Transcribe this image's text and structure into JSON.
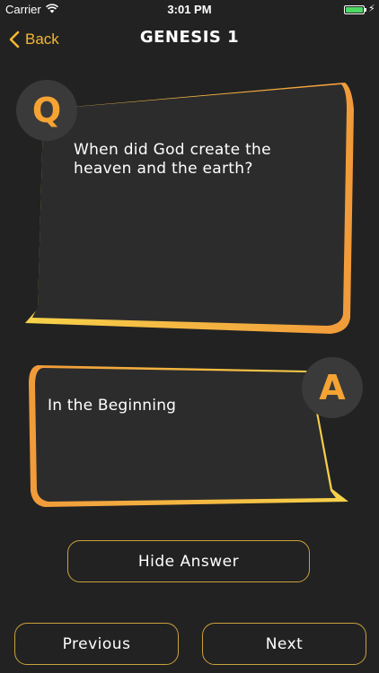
{
  "status_bar": {
    "carrier": "Carrier",
    "time": "3:01 PM"
  },
  "nav": {
    "back_label": "Back",
    "title": "GENESIS 1"
  },
  "question": {
    "badge": "Q",
    "text": "When did God create the heaven and the earth?"
  },
  "answer": {
    "badge": "A",
    "text": "In the Beginning"
  },
  "buttons": {
    "hide_answer": "Hide Answer",
    "previous": "Previous",
    "next": "Next"
  },
  "colors": {
    "background": "#222222",
    "card": "#2c2c2c",
    "accent": "#f5a333",
    "accent_light": "#f7d34a",
    "button_border": "#c9a23a",
    "battery": "#4cd964"
  },
  "icons": {
    "wifi": "wifi-icon",
    "battery": "battery-icon",
    "charging": "bolt-icon",
    "back": "chevron-left-icon"
  }
}
